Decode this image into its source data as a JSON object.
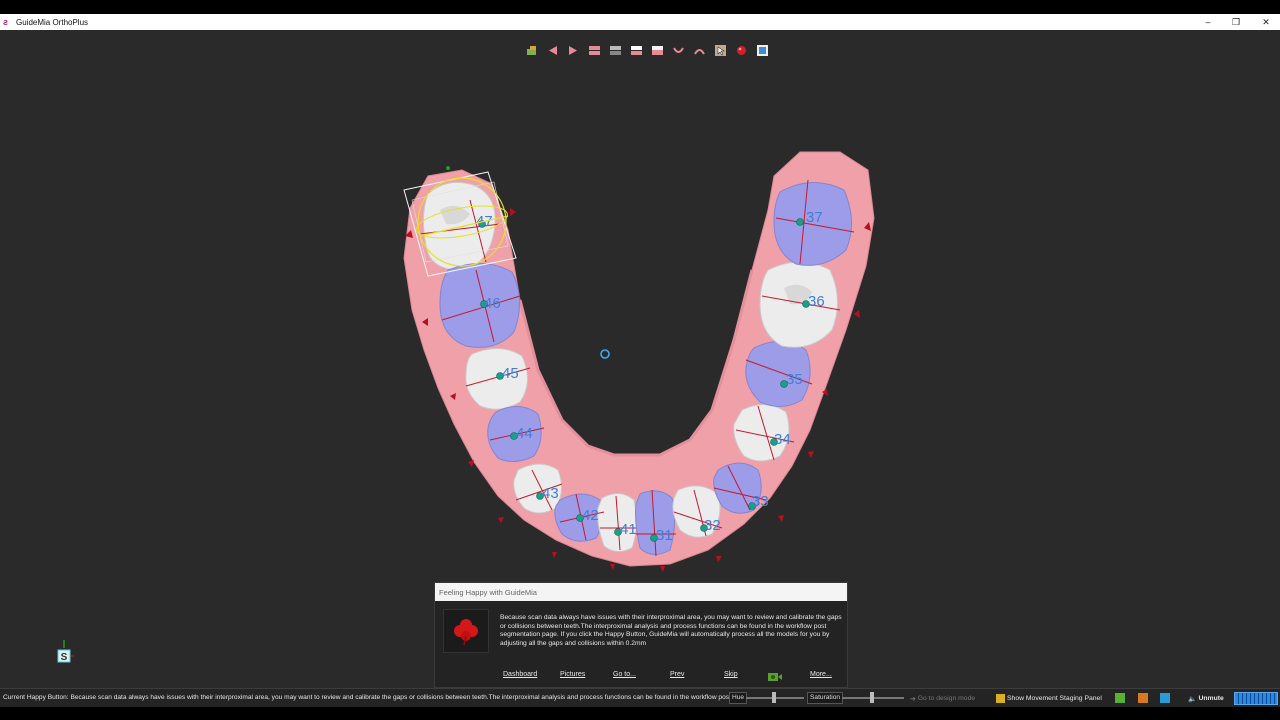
{
  "app": {
    "title": "GuideMia OrthoPlus"
  },
  "window_controls": {
    "minimize": "–",
    "restore": "❐",
    "close": "✕"
  },
  "toolbar": {
    "tools": [
      "front-view-icon",
      "left-view-icon",
      "right-view-icon",
      "upper-arch-icon",
      "both-arch-icon",
      "lower-arch-icon",
      "split-view-icon",
      "lower-jaw-icon",
      "upper-jaw-icon",
      "cursor-tool-icon",
      "red-sphere-icon",
      "fullscreen-icon"
    ]
  },
  "teeth": {
    "labels": [
      "47",
      "46",
      "45",
      "44",
      "43",
      "42",
      "41",
      "31",
      "32",
      "33",
      "34",
      "35",
      "36",
      "37"
    ]
  },
  "axis": {
    "label": "S"
  },
  "popup": {
    "title": "Feeling Happy with GuideMia",
    "message": "Because scan data always have issues with their interproximal area, you may want to review and calibrate the gaps or collisions between teeth.The interproximal analysis and process functions can be found in the workflow post segmentation page. If you click the Happy Button, GuideMia will automatically process all the models for you by adjusting all the gaps and collisions within 0.2mm",
    "links": {
      "dashboard": "Dashboard",
      "pictures": "Pictures",
      "goto": "Go to...",
      "prev": "Prev",
      "skip": "Skip",
      "more": "More..."
    }
  },
  "statusbar": {
    "text": "Current Happy Button: Because scan data always have issues with their interproximal area, you may want to review and calibrate the gaps or collisions between teeth.The interproximal analysis and process functions can be found in the workflow post segmentation page.",
    "hue_label": "Hue",
    "saturation_label": "Saturation",
    "design_mode": "Go to design mode",
    "movement_panel": "Show Movement Staging Panel",
    "unmute": "Unmute"
  },
  "colors": {
    "gum": "#f0a0a8",
    "tooth": "#ececec",
    "tooth_selected": "#9d9ce8",
    "label": "#3e7fd8",
    "center_dot": "#18a08a",
    "axis_line": "#c8182c"
  }
}
